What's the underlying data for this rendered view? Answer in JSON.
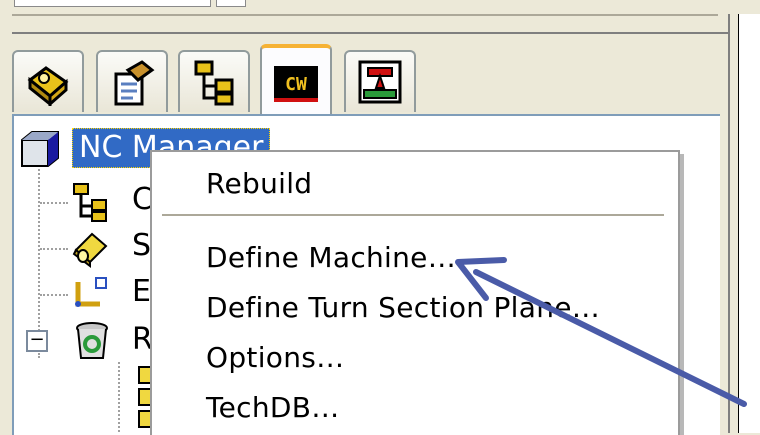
{
  "tabs": [
    {
      "icon": "feature-manager-icon"
    },
    {
      "icon": "property-manager-icon"
    },
    {
      "icon": "configuration-manager-icon"
    },
    {
      "icon": "camworks-icon",
      "label": "CW",
      "active": true
    },
    {
      "icon": "simulation-icon"
    }
  ],
  "tree": {
    "root": {
      "label": "NC Manager",
      "icon": "part-cube-icon"
    },
    "children": [
      {
        "label": "C",
        "icon": "configuration-tree-icon"
      },
      {
        "label": "S",
        "icon": "stock-icon"
      },
      {
        "label": "E",
        "icon": "coordinate-system-icon"
      },
      {
        "label": "R",
        "icon": "recycle-bin-icon",
        "expander": "−"
      }
    ]
  },
  "context_menu": {
    "items": [
      {
        "label": "Rebuild"
      },
      {
        "label": "Define Machine…"
      },
      {
        "label": "Define Turn Section Plane…"
      },
      {
        "label": "Options…"
      },
      {
        "label": "TechDB…"
      }
    ]
  },
  "colors": {
    "selection": "#316ac5",
    "annotation_arrow": "#4a5ba8",
    "tab_active_accent": "#f6b234"
  }
}
